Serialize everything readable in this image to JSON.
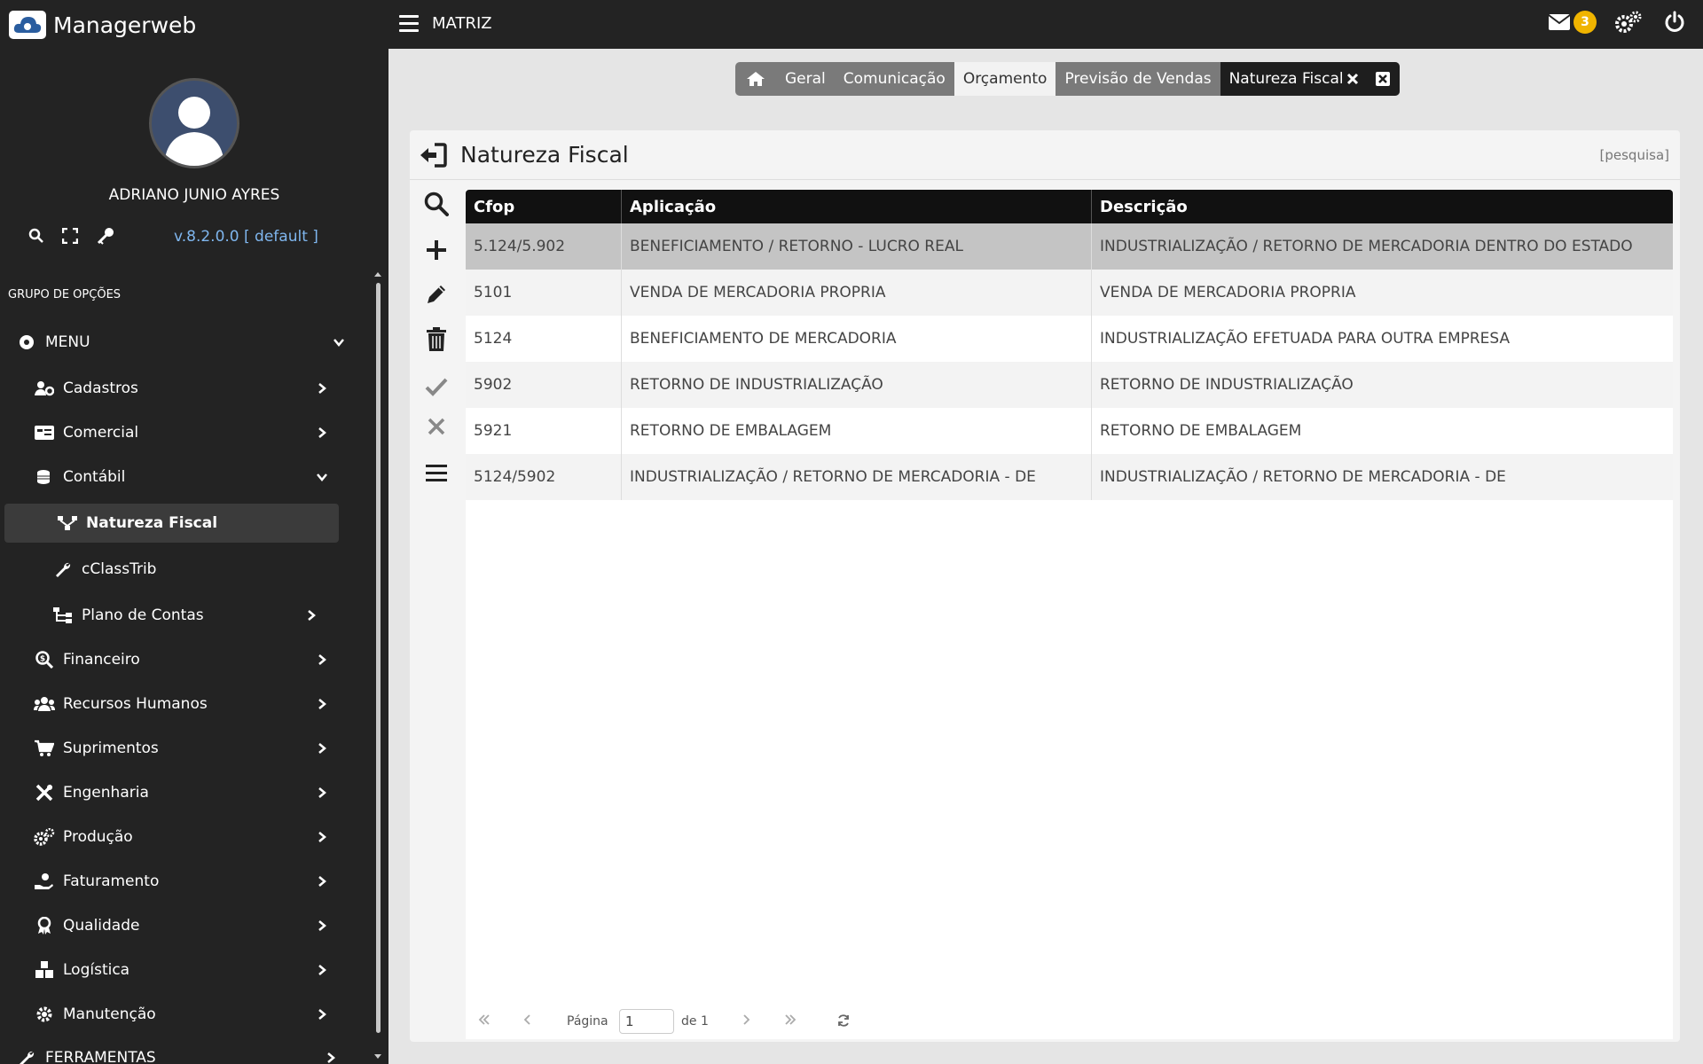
{
  "app": {
    "name": "Managerweb",
    "org": "MATRIZ"
  },
  "topbar": {
    "notification_count": "3"
  },
  "user": {
    "name": "ADRIANO JUNIO AYRES",
    "version": "v.8.2.0.0 [ default ]"
  },
  "sidebar": {
    "group_title": "GRUPO DE OPÇÕES",
    "items": [
      {
        "label": "MENU",
        "icon": "circle-dot-icon"
      },
      {
        "label": "Cadastros",
        "icon": "users-cog-icon"
      },
      {
        "label": "Comercial",
        "icon": "id-card-icon"
      },
      {
        "label": "Contábil",
        "icon": "coins-icon"
      },
      {
        "label": "Natureza Fiscal",
        "icon": "network-icon"
      },
      {
        "label": "cClassTrib",
        "icon": "wrench-icon"
      },
      {
        "label": "Plano de Contas",
        "icon": "sitemap-icon"
      },
      {
        "label": "Financeiro",
        "icon": "search-dollar-icon"
      },
      {
        "label": "Recursos Humanos",
        "icon": "users-icon"
      },
      {
        "label": "Suprimentos",
        "icon": "cart-icon"
      },
      {
        "label": "Engenharia",
        "icon": "tools-icon"
      },
      {
        "label": "Produção",
        "icon": "cogs-icon"
      },
      {
        "label": "Faturamento",
        "icon": "hand-coin-icon"
      },
      {
        "label": "Qualidade",
        "icon": "award-icon"
      },
      {
        "label": "Logística",
        "icon": "boxes-icon"
      },
      {
        "label": "Manutenção",
        "icon": "gear-icon"
      },
      {
        "label": "FERRAMENTAS",
        "icon": "wrench-icon"
      }
    ]
  },
  "tabs": [
    {
      "label": "Geral"
    },
    {
      "label": "Comunicação"
    },
    {
      "label": "Orçamento"
    },
    {
      "label": "Previsão de Vendas"
    },
    {
      "label": "Natureza Fiscal"
    }
  ],
  "panel": {
    "title": "Natureza Fiscal",
    "search_link": "[pesquisa]"
  },
  "grid": {
    "columns": [
      "Cfop",
      "Aplicação",
      "Descrição"
    ],
    "rows": [
      [
        "5.124/5.902",
        "BENEFICIAMENTO / RETORNO - LUCRO REAL",
        "INDUSTRIALIZAÇÃO / RETORNO DE MERCADORIA DENTRO DO ESTADO"
      ],
      [
        "5101",
        "VENDA DE MERCADORIA PROPRIA",
        "VENDA DE MERCADORIA PROPRIA"
      ],
      [
        "5124",
        "BENEFICIAMENTO DE MERCADORIA",
        "INDUSTRIALIZAÇÃO EFETUADA PARA OUTRA EMPRESA"
      ],
      [
        "5902",
        "RETORNO DE INDUSTRIALIZAÇÃO",
        "RETORNO DE INDUSTRIALIZAÇÃO"
      ],
      [
        "5921",
        "RETORNO DE EMBALAGEM",
        "RETORNO DE EMBALAGEM"
      ],
      [
        "5124/5902",
        "INDUSTRIALIZAÇÃO / RETORNO DE MERCADORIA - DE",
        "INDUSTRIALIZAÇÃO / RETORNO DE MERCADORIA - DE"
      ]
    ]
  },
  "pager": {
    "page_label": "Página",
    "page_value": "1",
    "of_label": "de 1"
  }
}
